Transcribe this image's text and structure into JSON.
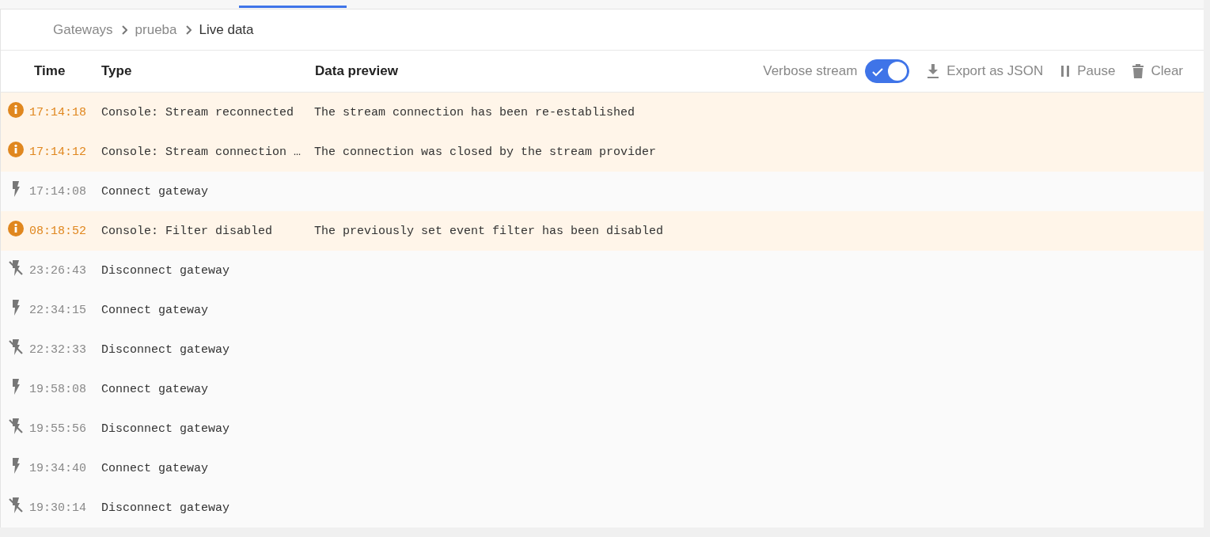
{
  "breadcrumb": [
    {
      "label": "Gateways",
      "current": false
    },
    {
      "label": "prueba",
      "current": false
    },
    {
      "label": "Live data",
      "current": true
    }
  ],
  "columns": [
    "Time",
    "Type",
    "Data preview"
  ],
  "toolbar": {
    "verbose": {
      "label": "Verbose stream",
      "on": true
    },
    "export": "Export as JSON",
    "pause": "Pause",
    "clear": "Clear"
  },
  "events": [
    {
      "kind": "info",
      "time": "17:14:18",
      "type": "Console: Stream reconnected",
      "preview": "The stream connection has been re-established"
    },
    {
      "kind": "info",
      "time": "17:14:12",
      "type": "Console: Stream connection …",
      "preview": "The connection was closed by the stream provider"
    },
    {
      "kind": "connect",
      "time": "17:14:08",
      "type": "Connect gateway"
    },
    {
      "kind": "info",
      "time": "08:18:52",
      "type": "Console: Filter disabled",
      "preview": "The previously set event filter has been disabled"
    },
    {
      "kind": "disconnect",
      "time": "23:26:43",
      "type": "Disconnect gateway"
    },
    {
      "kind": "connect",
      "time": "22:34:15",
      "type": "Connect gateway"
    },
    {
      "kind": "disconnect",
      "time": "22:32:33",
      "type": "Disconnect gateway"
    },
    {
      "kind": "connect",
      "time": "19:58:08",
      "type": "Connect gateway"
    },
    {
      "kind": "disconnect",
      "time": "19:55:56",
      "type": "Disconnect gateway"
    },
    {
      "kind": "connect",
      "time": "19:34:40",
      "type": "Connect gateway"
    },
    {
      "kind": "disconnect",
      "time": "19:30:14",
      "type": "Disconnect gateway"
    }
  ]
}
